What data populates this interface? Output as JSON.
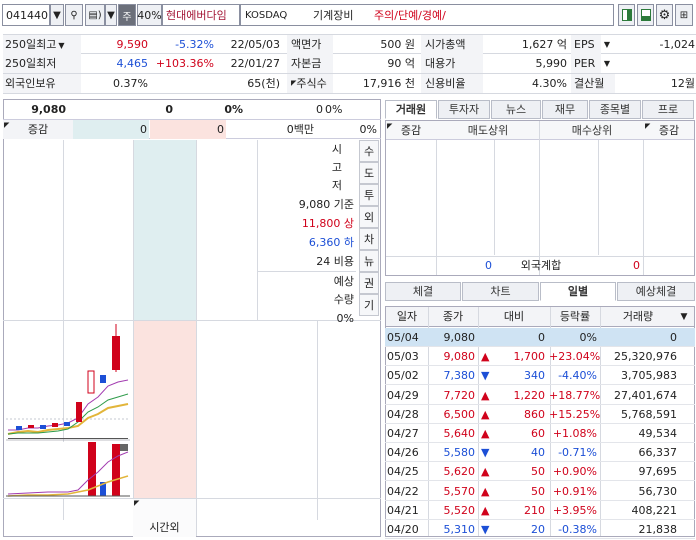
{
  "toolbar": {
    "code": "041440",
    "ju_label": "주",
    "percent": "40%",
    "name": "현대에버다임",
    "market": "KOSDAQ",
    "sector": "기계장비",
    "status": "주의/단예/경예/"
  },
  "info": {
    "r1": {
      "lbl": "250일최고",
      "price": "9,590",
      "pct": "-5.32%",
      "date": "22/05/03",
      "k1": "액면가",
      "v1": "500 원",
      "k2": "시가총액",
      "v2": "1,627 억",
      "k3": "EPS",
      "v3": "-1,024"
    },
    "r2": {
      "lbl": "250일최저",
      "price": "4,465",
      "pct": "+103.36%",
      "date": "22/01/27",
      "k1": "자본금",
      "v1": "90 억",
      "k2": "대용가",
      "v2": "5,990",
      "k3": "PER",
      "v3": ""
    },
    "r3": {
      "lbl": "외국인보유",
      "price": "0.37%",
      "shares": "65(천)",
      "k1": "주식수",
      "v1": "17,916 천",
      "k2": "신용비율",
      "v2": "4.30%",
      "k3": "결산월",
      "v3": "12월"
    }
  },
  "orderbook": {
    "price": "9,080",
    "zero1": "0",
    "pct": "0%",
    "zero2": "0",
    "pct2": "0%",
    "chg_label": "증감",
    "bid1": "0",
    "ask1": "0",
    "amount": "0백만",
    "amt_pct": "0%",
    "stats": [
      {
        "label": "시"
      },
      {
        "label": "고"
      },
      {
        "label": "저"
      },
      {
        "label": "9,080 기준"
      },
      {
        "label": "11,800 상"
      },
      {
        "label": "6,360 하"
      },
      {
        "label": "24 비용"
      },
      {
        "label": "예상"
      },
      {
        "label": "수량"
      },
      {
        "label": "0%"
      }
    ],
    "side_tabs": [
      "수",
      "도",
      "투",
      "외",
      "차",
      "뉴",
      "권",
      "기"
    ],
    "after_hours": "시간외"
  },
  "right_tabs": [
    "거래원",
    "투자자",
    "뉴스",
    "재무",
    "종목별",
    "프로"
  ],
  "broker": {
    "chg": "증감",
    "sell": "매도상위",
    "buy": "매수상위",
    "chg2": "증감",
    "foreign_l": "0",
    "foreign_label": "외국계합",
    "foreign_r": "0"
  },
  "bottom_tabs": [
    "체결",
    "차트",
    "일별",
    "예상체결"
  ],
  "daily": {
    "headers": [
      "일자",
      "종가",
      "대비",
      "등락률",
      "거래량"
    ],
    "rows": [
      {
        "date": "05/04",
        "close": "9,080",
        "arrow": "",
        "chg": "0",
        "pct": "0%",
        "vol": "0",
        "c": "n"
      },
      {
        "date": "05/03",
        "close": "9,080",
        "arrow": "▲",
        "chg": "1,700",
        "pct": "+23.04%",
        "vol": "25,320,976",
        "c": "r"
      },
      {
        "date": "05/02",
        "close": "7,380",
        "arrow": "▼",
        "chg": "340",
        "pct": "-4.40%",
        "vol": "3,705,983",
        "c": "b"
      },
      {
        "date": "04/29",
        "close": "7,720",
        "arrow": "▲",
        "chg": "1,220",
        "pct": "+18.77%",
        "vol": "27,401,674",
        "c": "r"
      },
      {
        "date": "04/28",
        "close": "6,500",
        "arrow": "▲",
        "chg": "860",
        "pct": "+15.25%",
        "vol": "5,768,591",
        "c": "r"
      },
      {
        "date": "04/27",
        "close": "5,640",
        "arrow": "▲",
        "chg": "60",
        "pct": "+1.08%",
        "vol": "49,534",
        "c": "r"
      },
      {
        "date": "04/26",
        "close": "5,580",
        "arrow": "▼",
        "chg": "40",
        "pct": "-0.71%",
        "vol": "66,337",
        "c": "b"
      },
      {
        "date": "04/25",
        "close": "5,620",
        "arrow": "▲",
        "chg": "50",
        "pct": "+0.90%",
        "vol": "97,695",
        "c": "r"
      },
      {
        "date": "04/22",
        "close": "5,570",
        "arrow": "▲",
        "chg": "50",
        "pct": "+0.91%",
        "vol": "56,730",
        "c": "r"
      },
      {
        "date": "04/21",
        "close": "5,520",
        "arrow": "▲",
        "chg": "210",
        "pct": "+3.95%",
        "vol": "408,221",
        "c": "r"
      },
      {
        "date": "04/20",
        "close": "5,310",
        "arrow": "▼",
        "chg": "20",
        "pct": "-0.38%",
        "vol": "21,838",
        "c": "b"
      }
    ]
  },
  "colors": {
    "up": "#d0021b",
    "down": "#1c4fd6",
    "ask_bg": "#dfeef0",
    "bid_bg": "#fbe3df",
    "header_bg": "#f3f4f7"
  }
}
